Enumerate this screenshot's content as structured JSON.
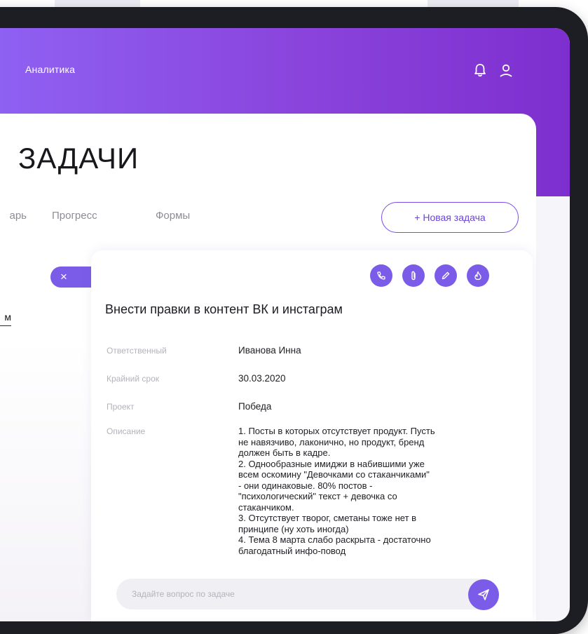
{
  "header": {
    "nav_label": "Аналитика",
    "icons": [
      "bell-icon",
      "user-icon"
    ]
  },
  "page": {
    "title": "ЗАДАЧИ",
    "tabs": [
      {
        "label": "арь"
      },
      {
        "label": "Прогресс"
      },
      {
        "label": "Формы"
      }
    ],
    "new_task_label": "+ Новая задача",
    "close_label": "×",
    "left_fragment": "м"
  },
  "task": {
    "action_icons": [
      "phone-icon",
      "attachment-icon",
      "edit-icon",
      "flame-icon"
    ],
    "title": "Внести правки в контент ВК и инстаграм",
    "fields": [
      {
        "label": "Ответственный",
        "value": "Иванова Инна"
      },
      {
        "label": "Крайний срок",
        "value": "30.03.2020"
      },
      {
        "label": "Проект",
        "value": "Победа"
      }
    ],
    "description_label": "Описание",
    "description": "1. Посты в которых отсутствует продукт. Пусть\nне навязчиво, лаконично, но продукт, бренд\nдолжен быть в кадре.\n2. Однообразные имиджи в набившими уже\nвсем оскомину \"Девочками со стаканчиками\"\n- они  одинаковые. 80% постов -\n\"психологический\" текст + девочка со\nстаканчиком.\n3. Отсутствует творог, сметаны тоже нет в\nпринципе (ну хоть иногда)\n4. Тема 8 марта слабо раскрыта - достаточно\nблагодатный инфо-повод"
  },
  "ask": {
    "placeholder": "Задайте вопрос по задаче"
  },
  "colors": {
    "accent": "#7b5ce8",
    "header_gradient_start": "#8f63f5",
    "header_gradient_end": "#7e2fcf",
    "device_frame": "#1d1e24"
  }
}
